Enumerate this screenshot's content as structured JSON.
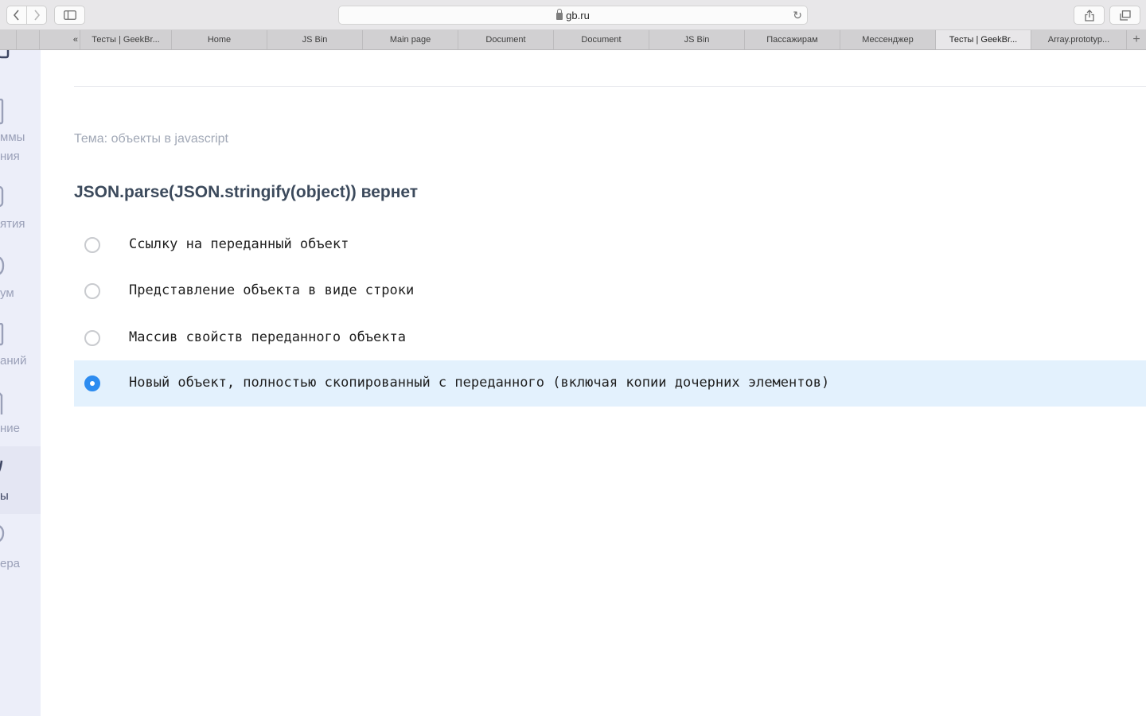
{
  "browser": {
    "url": "gb.ru",
    "new_tab_symbol": "+",
    "tabs": [
      {
        "label": ""
      },
      {
        "label": ""
      },
      {
        "label": "«"
      },
      {
        "label": "Тесты | GeekBr..."
      },
      {
        "label": "Home"
      },
      {
        "label": "JS Bin"
      },
      {
        "label": "Main page"
      },
      {
        "label": "Document"
      },
      {
        "label": "Document"
      },
      {
        "label": "JS Bin"
      },
      {
        "label": "Пассажирам"
      },
      {
        "label": "Мессенджер"
      },
      {
        "label": "Тесты | GeekBr..."
      },
      {
        "label": "Array.prototyp..."
      }
    ],
    "active_tab_index": 12
  },
  "sidebar": {
    "items": [
      {
        "label_line1": "ммы",
        "label_line2": "ния",
        "icon": "book-icon"
      },
      {
        "label_line1": "ятия",
        "icon": "calendar-icon"
      },
      {
        "label_line1": "ум",
        "icon": "chat-icon"
      },
      {
        "label_line1": "аний",
        "icon": "list-icon"
      },
      {
        "label_line1": "ние",
        "icon": "building-icon"
      },
      {
        "label_line1": "ы",
        "icon": "pencil-icon",
        "active": true
      },
      {
        "label_line1": "ера",
        "icon": "chat-icon"
      }
    ]
  },
  "test": {
    "topic": "Тема: объекты в javascript",
    "question": "JSON.parse(JSON.stringify(object)) вернет",
    "answers": [
      {
        "text": "Ссылку на переданный объект",
        "selected": false
      },
      {
        "text": "Представление объекта в виде строки",
        "selected": false
      },
      {
        "text": "Массив свойств переданного объекта",
        "selected": false
      },
      {
        "text": "Новый объект, полностью скопированный с переданного (включая копии дочерних элементов)",
        "selected": true
      }
    ]
  },
  "colors": {
    "accent": "#2d8cf0",
    "selected_bg": "#e3f1fd",
    "sidebar_bg": "#eceef9"
  }
}
